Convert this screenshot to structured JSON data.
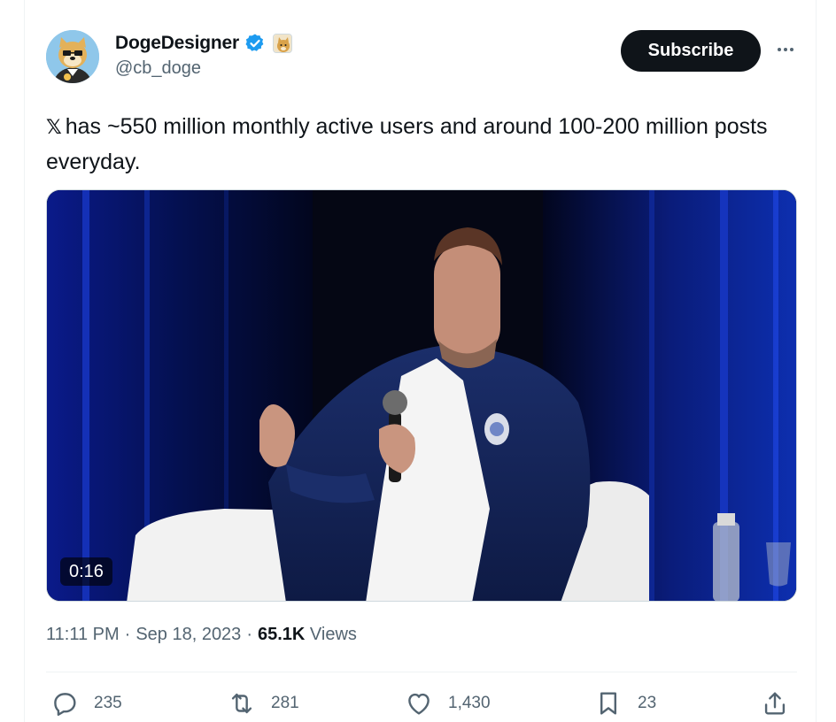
{
  "author": {
    "display_name": "DogeDesigner",
    "handle": "@cb_doge",
    "avatar_icon": "doge-avatar-icon",
    "verified_icon": "verified-badge-icon",
    "affiliation_icon": "doge-affiliate-badge-icon"
  },
  "header": {
    "subscribe_label": "Subscribe",
    "more_icon": "more-options-icon"
  },
  "tweet": {
    "x_logo": "𝕏",
    "text": "has ~550 million monthly active users and around 100-200 million posts everyday."
  },
  "media": {
    "type": "video",
    "duration": "0:16"
  },
  "meta": {
    "time": "11:11 PM",
    "separator1": "·",
    "date": "Sep 18, 2023",
    "separator2": "·",
    "views_count": "65.1K",
    "views_label": "Views"
  },
  "actions": {
    "replies": "235",
    "reposts": "281",
    "likes": "1,430",
    "bookmarks": "23"
  },
  "colors": {
    "text": "#0f1419",
    "secondary": "#536471",
    "verified": "#1d9bf0",
    "button_bg": "#0f1419",
    "border": "#eff3f4"
  }
}
